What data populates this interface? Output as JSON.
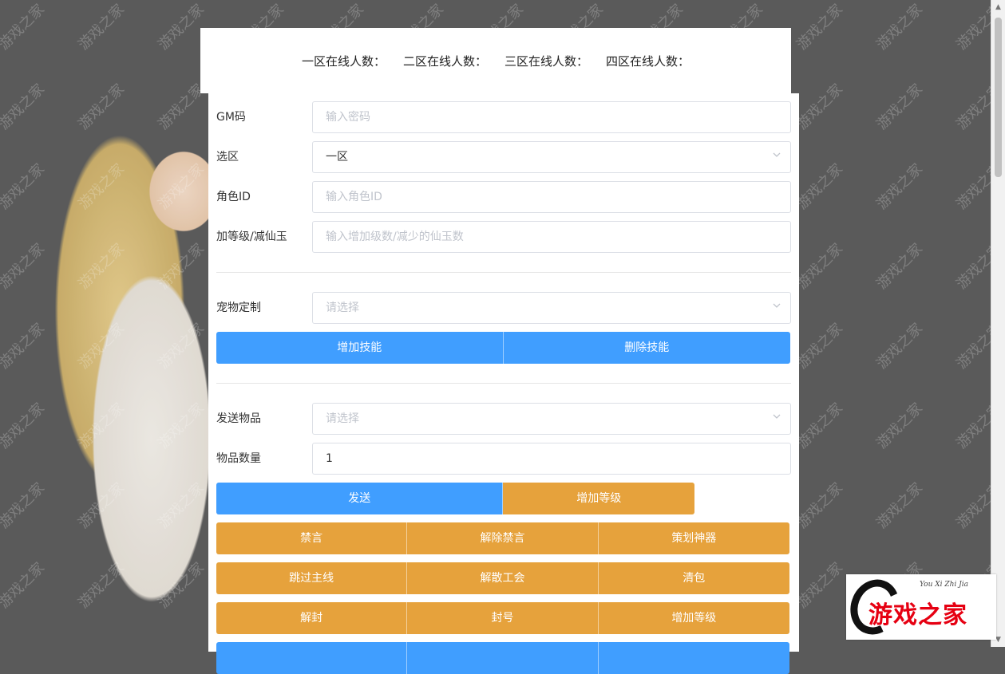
{
  "header": {
    "zone1": "一区在线人数：",
    "zone2": "二区在线人数：",
    "zone3": "三区在线人数：",
    "zone4": "四区在线人数："
  },
  "form": {
    "gm_code": {
      "label": "GM码",
      "placeholder": "输入密码"
    },
    "zone": {
      "label": "选区",
      "value": "一区"
    },
    "role_id": {
      "label": "角色ID",
      "placeholder": "输入角色ID"
    },
    "level": {
      "label": "加等级/减仙玉",
      "placeholder": "输入增加级数/减少的仙玉数"
    },
    "pet": {
      "label": "宠物定制",
      "placeholder": "请选择"
    },
    "send_item": {
      "label": "发送物品",
      "placeholder": "请选择"
    },
    "item_qty": {
      "label": "物品数量",
      "value": "1"
    }
  },
  "buttons": {
    "add_skill": "增加技能",
    "delete_skill": "删除技能",
    "send": "发送",
    "add_level_1": "增加等级",
    "mute": "禁言",
    "unmute": "解除禁言",
    "plan_artifact": "策划神器",
    "skip_main": "跳过主线",
    "dissolve_guild": "解散工会",
    "clear_bag": "清包",
    "unban": "解封",
    "ban": "封号",
    "add_level_2": "增加等级"
  },
  "watermark": "游戏之家",
  "logo": {
    "text": "游戏之家",
    "pinyin": "You Xi Zhi Jia"
  },
  "colors": {
    "primary": "#409eff",
    "warning": "#e6a23c",
    "background": "#5a5a5a"
  }
}
